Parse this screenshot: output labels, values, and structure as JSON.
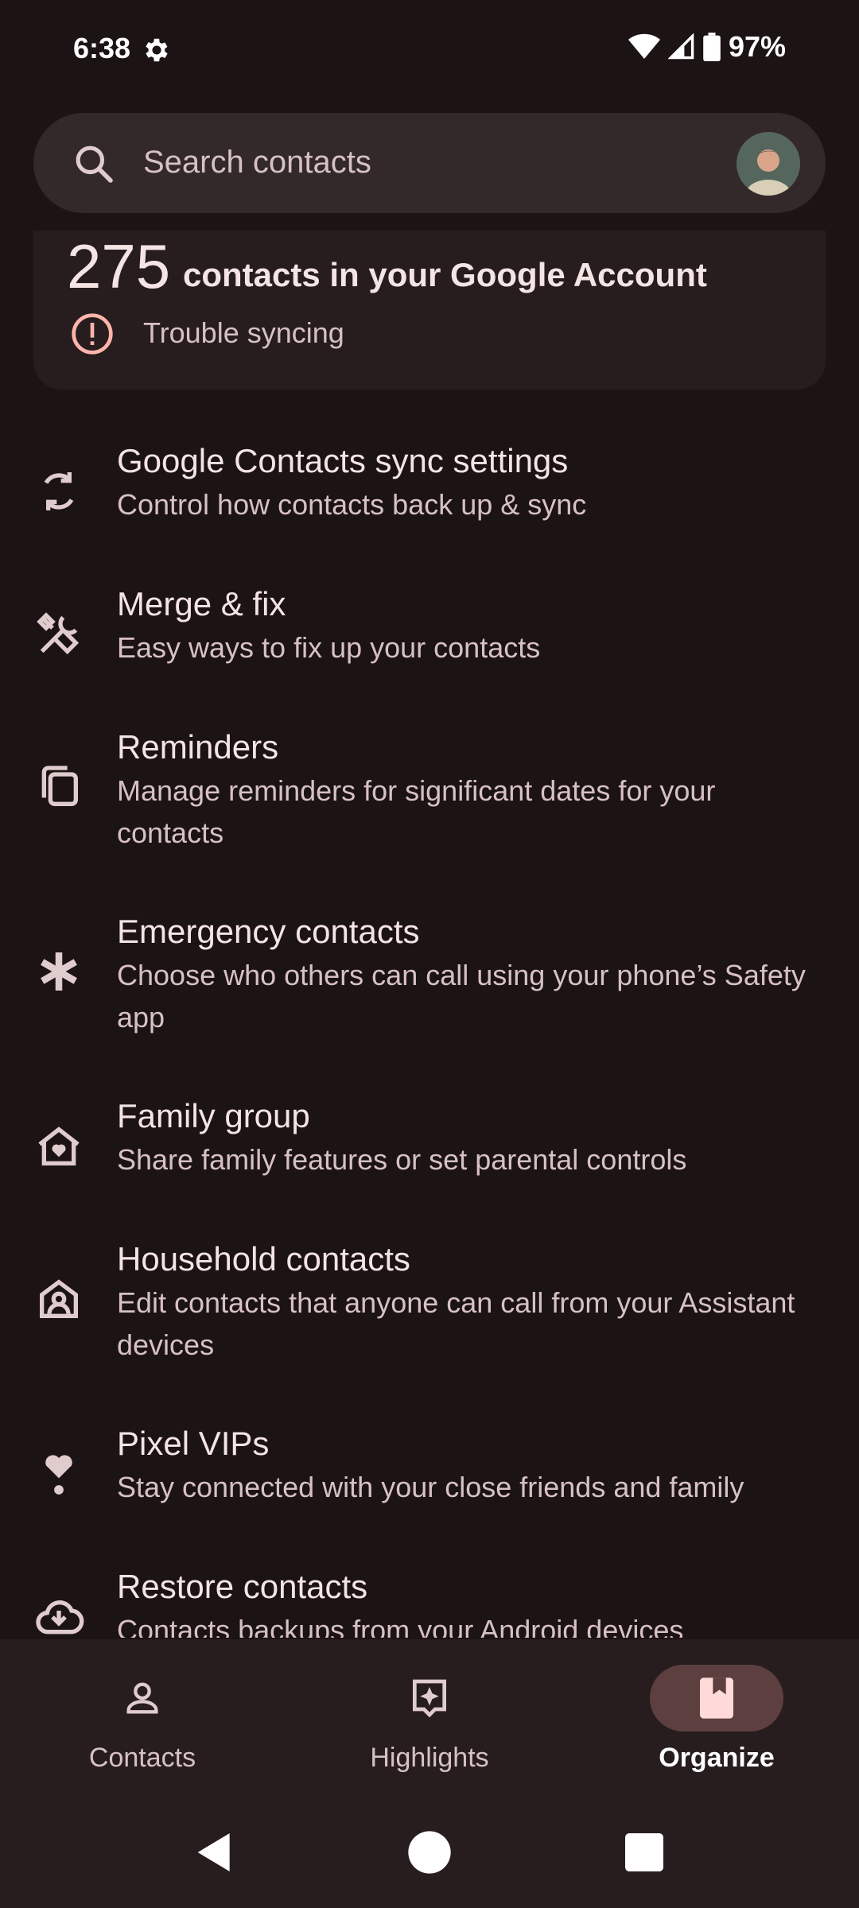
{
  "status_bar": {
    "time": "6:38",
    "battery": "97%",
    "icons": [
      "gear-icon",
      "wifi-icon",
      "signal-icon",
      "battery-icon"
    ]
  },
  "search": {
    "placeholder": "Search contacts"
  },
  "account_card": {
    "count": "275",
    "count_label": "contacts in your Google Account",
    "status": "Trouble syncing"
  },
  "items": [
    {
      "title": "Google Contacts sync settings",
      "subtitle": "Control how contacts back up & sync",
      "icon": "sync-icon"
    },
    {
      "title": "Merge & fix",
      "subtitle": "Easy ways to fix up your contacts",
      "icon": "tools-icon"
    },
    {
      "title": "Reminders",
      "subtitle": "Manage reminders for significant dates for your contacts",
      "icon": "reminders-icon"
    },
    {
      "title": "Emergency contacts",
      "subtitle": "Choose who others can call using your phone’s Safety app",
      "icon": "asterisk-icon"
    },
    {
      "title": "Family group",
      "subtitle": "Share family features or set parental controls",
      "icon": "family-home-icon"
    },
    {
      "title": "Household contacts",
      "subtitle": "Edit contacts that anyone can call from your Assistant devices",
      "icon": "household-icon"
    },
    {
      "title": "Pixel VIPs",
      "subtitle": "Stay connected with your close friends and family",
      "icon": "vip-heart-icon"
    },
    {
      "title": "Restore contacts",
      "subtitle": "Contacts backups from your Android devices",
      "icon": "cloud-restore-icon"
    }
  ],
  "bottom_nav": {
    "tabs": [
      {
        "label": "Contacts",
        "icon": "person-icon",
        "active": false
      },
      {
        "label": "Highlights",
        "icon": "highlights-icon",
        "active": false
      },
      {
        "label": "Organize",
        "icon": "bookmark-icon",
        "active": true
      }
    ]
  },
  "colors": {
    "background": "#1c1314",
    "surface": "#271d1f",
    "search_bg": "#33282a",
    "active_pill": "#5d3f40",
    "text_primary": "#f5e4e4",
    "text_secondary": "#d7c1c2",
    "warning": "#ffb4ab"
  }
}
